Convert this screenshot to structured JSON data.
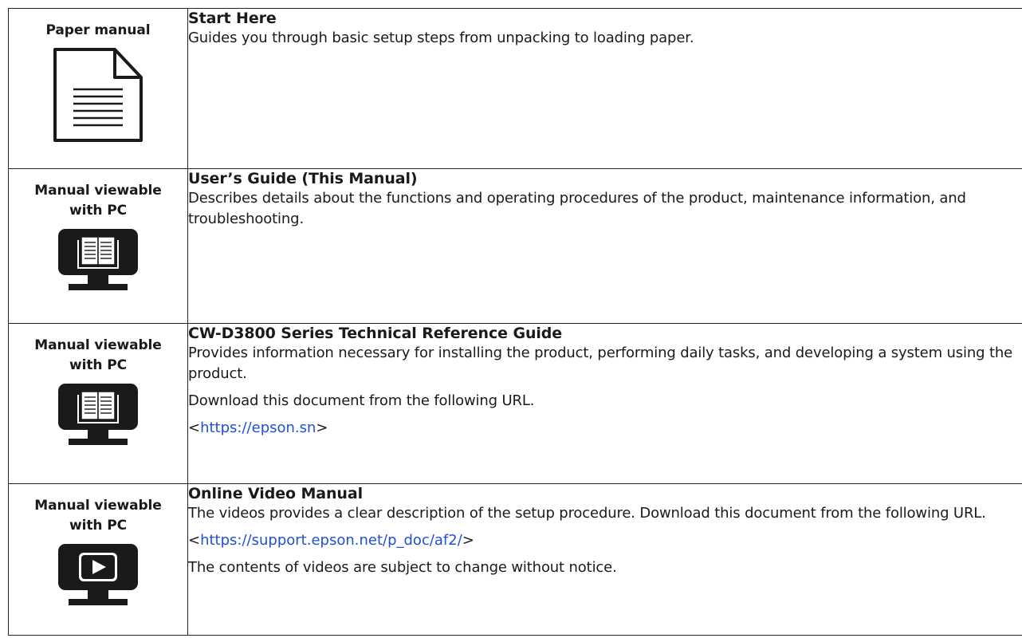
{
  "rows": [
    {
      "media_label": "Paper manual",
      "media_icon": "paper-document-icon",
      "title": "Start Here",
      "description": "Guides you through basic setup steps from unpacking to loading paper."
    },
    {
      "media_label": "Manual viewable with PC",
      "media_icon": "monitor-book-icon",
      "title": "User’s Guide (This Manual)",
      "description": "Describes details about the functions and operating procedures of the product, maintenance information, and troubleshooting."
    },
    {
      "media_label": "Manual viewable with PC",
      "media_icon": "monitor-book-icon",
      "title": "CW-D3800 Series Technical Reference Guide",
      "description": "Provides information necessary for installing the product, performing daily tasks, and developing a system using the product.",
      "download_text": "Download this document from the following URL.",
      "url_open": "<",
      "url": "https://epson.sn",
      "url_close": ">"
    },
    {
      "media_label": "Manual viewable with PC",
      "media_icon": "monitor-video-icon",
      "title": "Online Video Manual",
      "description": "The videos provides a clear description of the setup procedure. Download this document from the following URL.",
      "url_open": "<",
      "url": "https://support.epson.net/p_doc/af2/",
      "url_close": ">",
      "note": "The contents of videos are subject to change without notice."
    }
  ],
  "colors": {
    "link": "#1f4fd6",
    "border": "#222222",
    "text": "#1a1a1a"
  }
}
